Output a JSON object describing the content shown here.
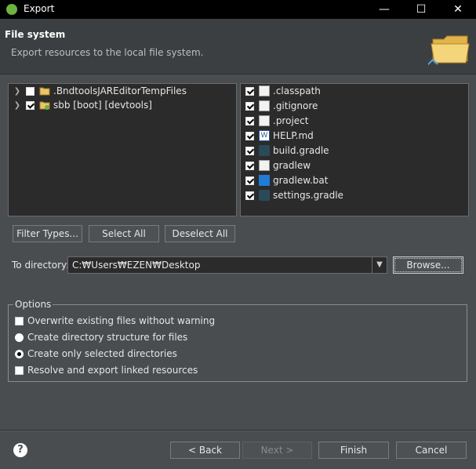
{
  "window": {
    "title": "Export",
    "minimize": "—",
    "maximize": "☐",
    "close": "✕"
  },
  "header": {
    "title": "File system",
    "description": "Export resources to the local file system."
  },
  "tree": [
    {
      "label": ".BndtoolsJAREditorTempFiles",
      "checked": false,
      "icon": "folder-icon"
    },
    {
      "label": "sbb [boot] [devtools]",
      "checked": true,
      "icon": "project-icon"
    }
  ],
  "files": [
    {
      "label": ".classpath",
      "icon": "doc-icon"
    },
    {
      "label": ".gitignore",
      "icon": "doc-icon"
    },
    {
      "label": ".project",
      "icon": "doc-icon"
    },
    {
      "label": "HELP.md",
      "icon": "word-icon"
    },
    {
      "label": "build.gradle",
      "icon": "gradle-icon"
    },
    {
      "label": "gradlew",
      "icon": "doc-icon"
    },
    {
      "label": "gradlew.bat",
      "icon": "bat-icon"
    },
    {
      "label": "settings.gradle",
      "icon": "gradle-icon"
    }
  ],
  "buttons": {
    "filter_types": "Filter Types...",
    "select_all": "Select All",
    "deselect_all": "Deselect All",
    "browse": "Browse..."
  },
  "directory": {
    "label": "To directory:",
    "value": "C:₩Users₩EZEN₩Desktop"
  },
  "options": {
    "legend": "Options",
    "overwrite": "Overwrite existing files without warning",
    "create_structure": "Create directory structure for files",
    "create_only_selected": "Create only selected directories",
    "resolve_linked": "Resolve and export linked resources"
  },
  "footer": {
    "back": "< Back",
    "next": "Next >",
    "finish": "Finish",
    "cancel": "Cancel",
    "help": "?"
  }
}
